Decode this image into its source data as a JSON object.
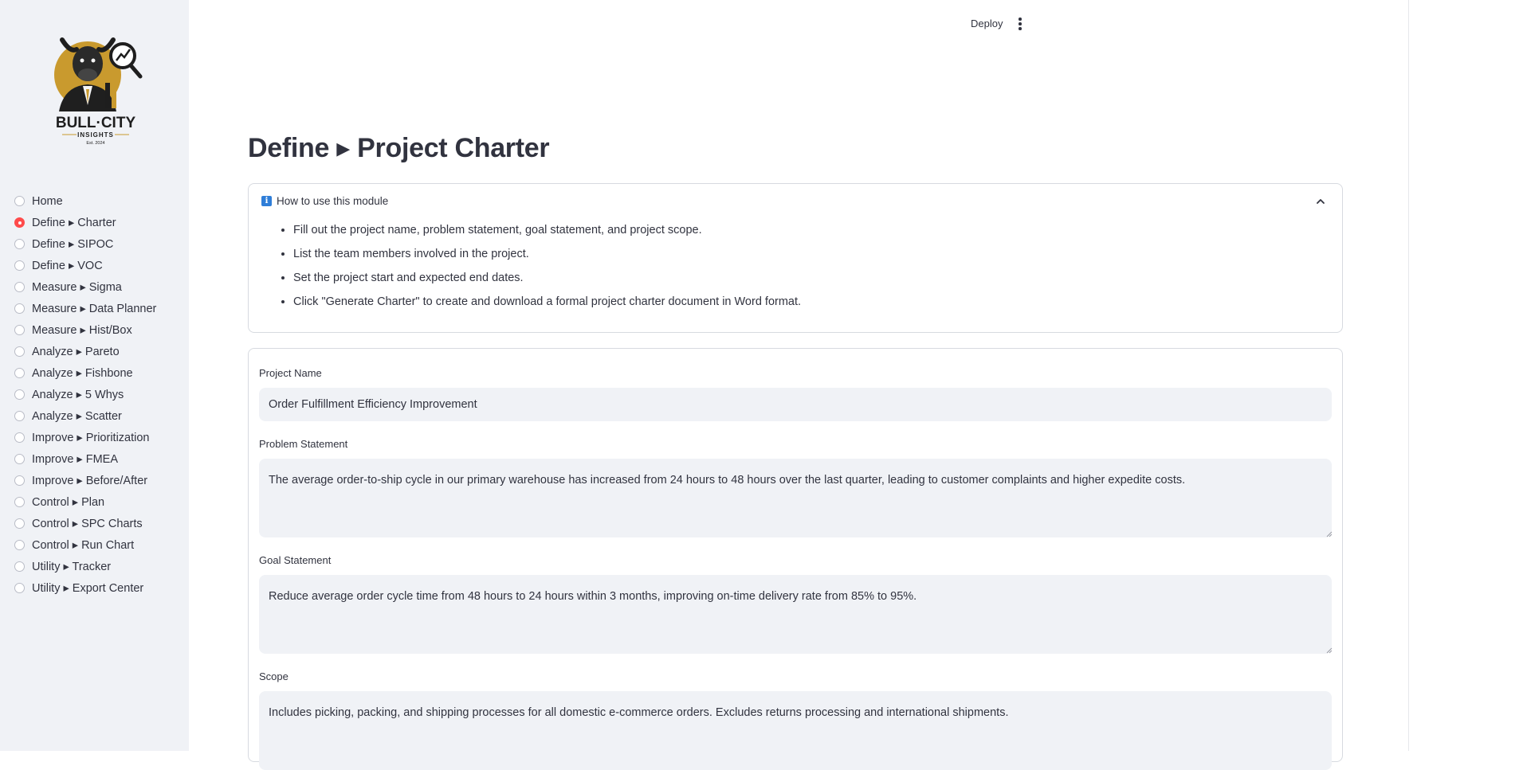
{
  "sidebar": {
    "logo": {
      "brand_line1": "BULL·CITY",
      "brand_line2": "INSIGHTS",
      "brand_line3": "Est. 2024",
      "accent_color": "#c99a2e"
    },
    "selected_index": 1,
    "items": [
      {
        "label": "Home"
      },
      {
        "label": "Define ▸ Charter"
      },
      {
        "label": "Define ▸ SIPOC"
      },
      {
        "label": "Define ▸ VOC"
      },
      {
        "label": "Measure ▸ Sigma"
      },
      {
        "label": "Measure ▸ Data Planner"
      },
      {
        "label": "Measure ▸ Hist/Box"
      },
      {
        "label": "Analyze ▸ Pareto"
      },
      {
        "label": "Analyze ▸ Fishbone"
      },
      {
        "label": "Analyze ▸ 5 Whys"
      },
      {
        "label": "Analyze ▸ Scatter"
      },
      {
        "label": "Improve ▸ Prioritization"
      },
      {
        "label": "Improve ▸ FMEA"
      },
      {
        "label": "Improve ▸ Before/After"
      },
      {
        "label": "Control ▸ Plan"
      },
      {
        "label": "Control ▸ SPC Charts"
      },
      {
        "label": "Control ▸ Run Chart"
      },
      {
        "label": "Utility ▸ Tracker"
      },
      {
        "label": "Utility ▸ Export Center"
      }
    ]
  },
  "toolbar": {
    "deploy_label": "Deploy",
    "menu_icon": "kebab-menu-icon"
  },
  "page": {
    "title": "Define ▸ Project Charter"
  },
  "help": {
    "icon": "info-icon",
    "title": "How to use this module",
    "expanded": true,
    "items": [
      "Fill out the project name, problem statement, goal statement, and project scope.",
      "List the team members involved in the project.",
      "Set the project start and expected end dates.",
      "Click \"Generate Charter\" to create and download a formal project charter document in Word format."
    ]
  },
  "form": {
    "project_name": {
      "label": "Project Name",
      "value": "Order Fulfillment Efficiency Improvement"
    },
    "problem_statement": {
      "label": "Problem Statement",
      "value": "The average order-to-ship cycle in our primary warehouse has increased from 24 hours to 48 hours over the last quarter, leading to customer complaints and higher expedite costs."
    },
    "goal_statement": {
      "label": "Goal Statement",
      "value": "Reduce average order cycle time from 48 hours to 24 hours within 3 months, improving on-time delivery rate from 85% to 95%."
    },
    "scope": {
      "label": "Scope",
      "value": "Includes picking, packing, and shipping processes for all domestic e-commerce orders. Excludes returns processing and international shipments."
    }
  },
  "colors": {
    "accent": "#ff4b4b",
    "sidebar_bg": "#f0f2f6",
    "field_bg": "#f0f2f6",
    "text": "#31333f",
    "info_icon": "#2f7ed8"
  }
}
